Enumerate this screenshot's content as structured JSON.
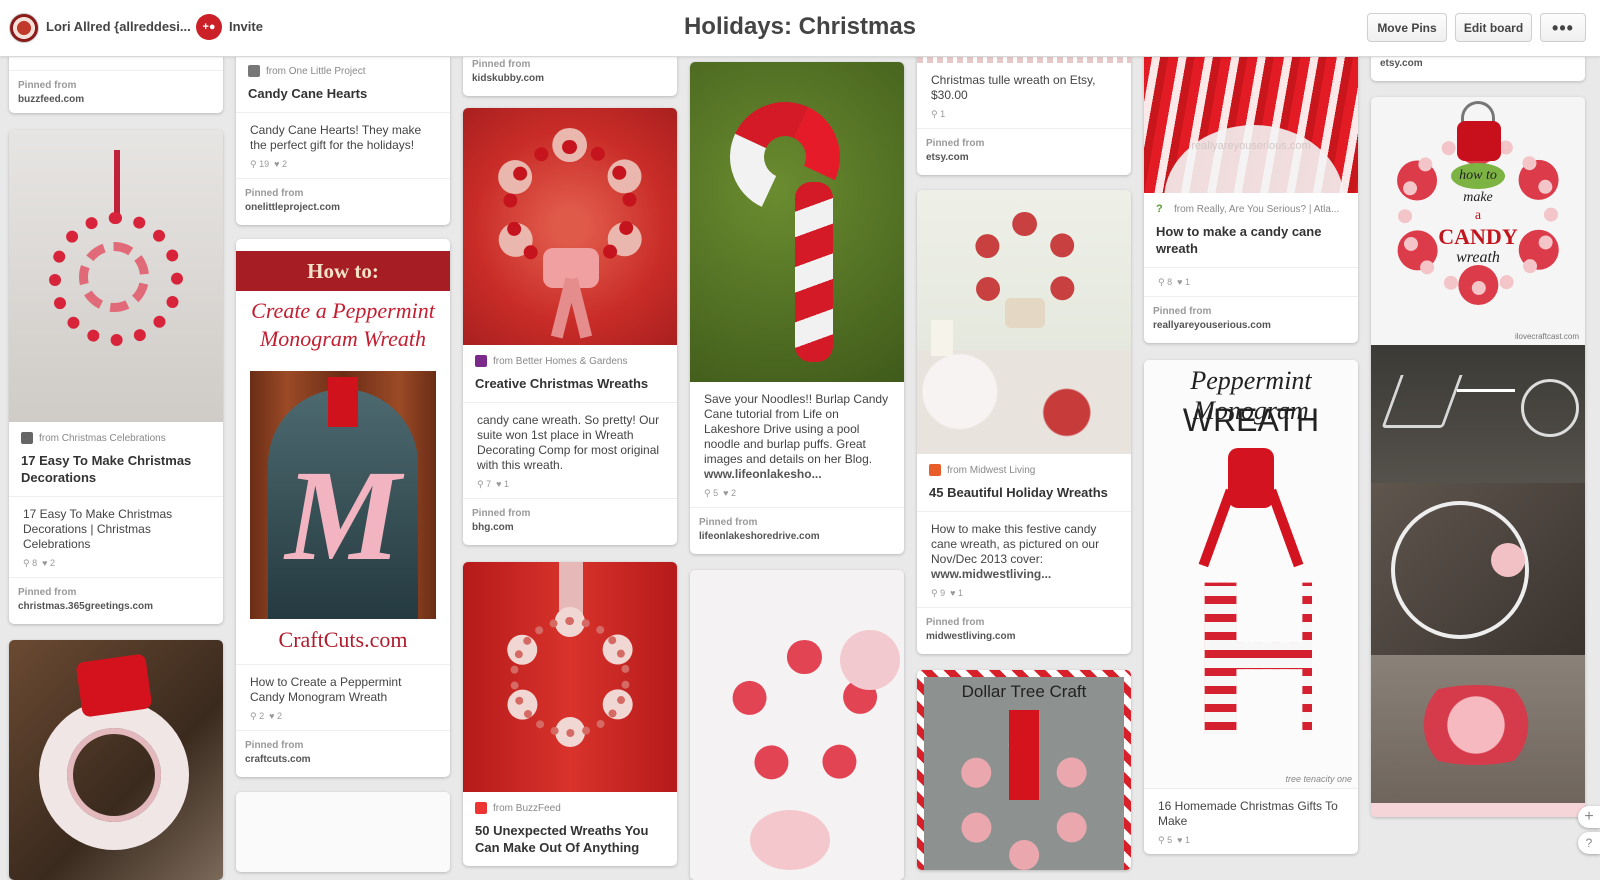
{
  "header": {
    "owner_name": "Lori Allred {allreddesi...",
    "invite_label": "Invite",
    "board_title": "Holidays: Christmas",
    "move_pins": "Move Pins",
    "edit_board": "Edit board",
    "more": "•••"
  },
  "icons": {
    "invite": "add-person-icon",
    "repin": "pin-icon",
    "like": "heart-icon",
    "more": "more-dots-icon"
  },
  "colors": {
    "accent": "#cb2027",
    "background": "#e9e9e9"
  },
  "pins": {
    "p1": {
      "pinned_label": "Pinned from",
      "domain": "buzzfeed.com"
    },
    "p2": {
      "source": "from Christmas Celebrations",
      "title": "17 Easy To Make Christmas Decorations",
      "desc": "17 Easy To Make Christmas Decorations | Christmas Celebrations",
      "repins": "8",
      "likes": "2",
      "pinned_label": "Pinned from",
      "domain": "christmas.365greetings.com"
    },
    "p4": {
      "source": "from One Little Project",
      "title": "Candy Cane Hearts",
      "desc": "Candy Cane Hearts! They make the perfect gift for the holidays!",
      "repins": "19",
      "likes": "2",
      "pinned_label": "Pinned from",
      "domain": "onelittleproject.com"
    },
    "p5": {
      "banner": "How to:",
      "script_title": "Create a Peppermint Monogram Wreath",
      "letter": "M",
      "brand": "CraftCuts.com",
      "desc": "How to Create a Peppermint Candy Monogram Wreath",
      "repins": "2",
      "likes": "2",
      "pinned_label": "Pinned from",
      "domain": "craftcuts.com"
    },
    "p7": {
      "pinned_label": "Pinned from",
      "domain": "kidskubby.com"
    },
    "p8": {
      "source": "from Better Homes & Gardens",
      "title": "Creative Christmas Wreaths",
      "desc": "candy cane wreath. So pretty! Our suite won 1st place in Wreath Decorating Comp for most original with this wreath.",
      "repins": "7",
      "likes": "1",
      "pinned_label": "Pinned from",
      "domain": "bhg.com"
    },
    "p9": {
      "source": "from BuzzFeed",
      "title": "50 Unexpected Wreaths You Can Make Out Of Anything"
    },
    "p10": {
      "desc": "Save your Noodles!! Burlap Candy Cane tutorial from Life on Lakeshore Drive using a pool noodle and burlap puffs. Great images and details on her Blog.",
      "desc_link": "www.lifeonlakesho...",
      "repins": "5",
      "likes": "2",
      "pinned_label": "Pinned from",
      "domain": "lifeonlakeshoredrive.com"
    },
    "p12": {
      "desc": "Christmas tulle wreath on Etsy, $30.00",
      "repins": "1",
      "pinned_label": "Pinned from",
      "domain": "etsy.com"
    },
    "p13": {
      "source": "from Midwest Living",
      "title": "45 Beautiful Holiday Wreaths",
      "desc": "How to make this festive candy cane wreath, as pictured on our Nov/Dec 2013 cover:",
      "desc_link": "www.midwestliving...",
      "repins": "9",
      "likes": "1",
      "pinned_label": "Pinned from",
      "domain": "midwestliving.com"
    },
    "p14": {
      "overlay": "Dollar Tree Craft"
    },
    "p15": {
      "watermark": "reallyareyouserious.com",
      "source": "from Really, Are You Serious? | Atla...",
      "title": "How to make a candy cane wreath",
      "repins": "8",
      "likes": "1",
      "pinned_label": "Pinned from",
      "domain": "reallyareyouserious.com"
    },
    "p16": {
      "script_title": "Peppermint Monogram",
      "word": "WREATH",
      "letter": "H",
      "credit": "tree tenacity one",
      "desc": "16 Homemade Christmas Gifts To Make",
      "repins": "5",
      "likes": "1"
    },
    "p17": {
      "domain": "etsy.com"
    },
    "p18": {
      "line1": "how to",
      "line2": "make",
      "line3": "a",
      "line4": "CANDY",
      "line5": "wreath",
      "credit": "ilovecraftcast.com"
    }
  }
}
